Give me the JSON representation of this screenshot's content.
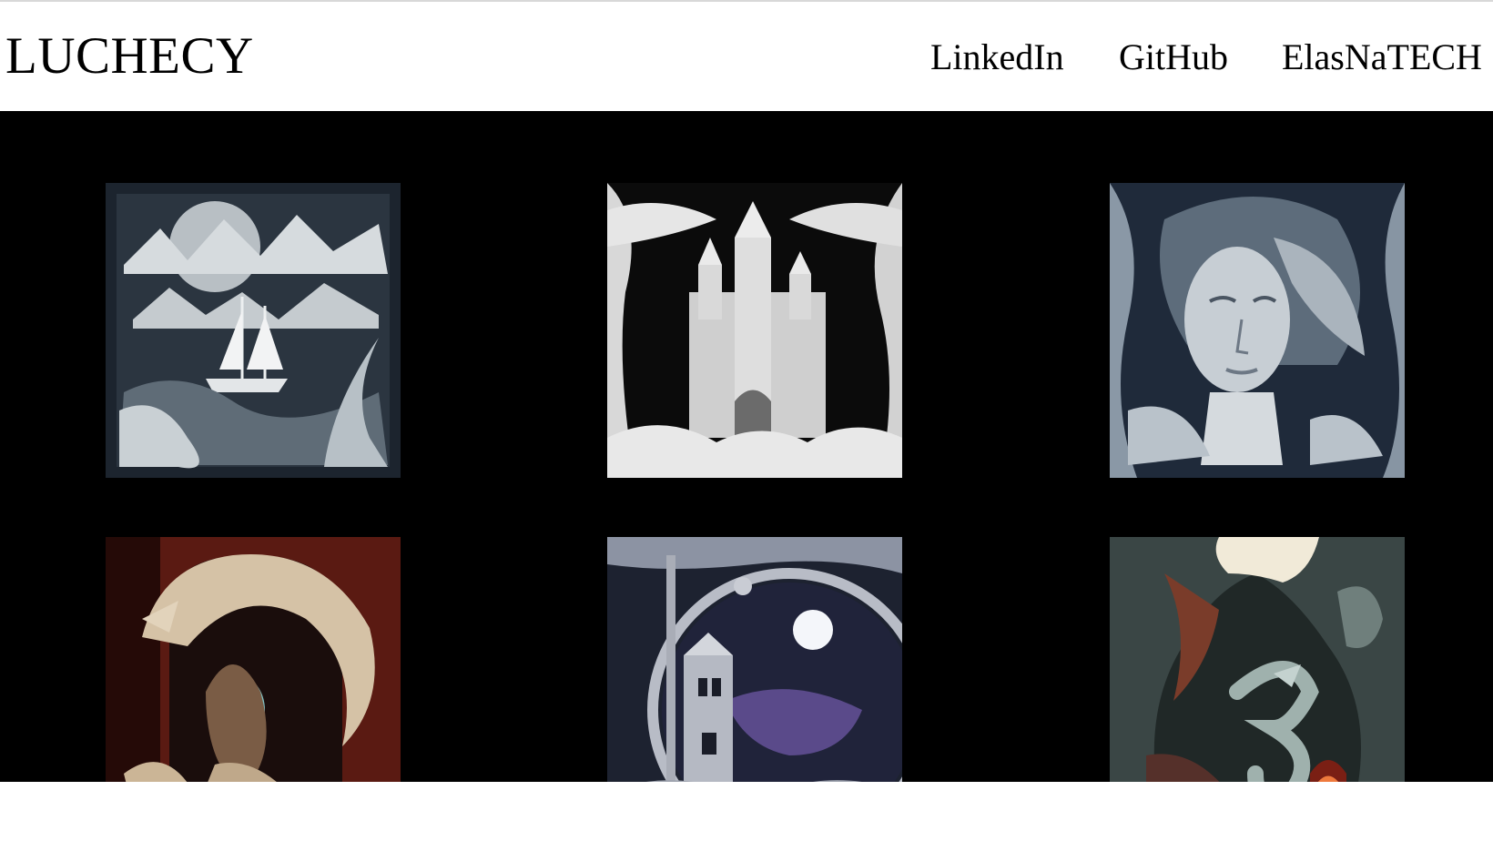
{
  "header": {
    "brand": "LUCHECY",
    "nav": [
      {
        "label": "LinkedIn"
      },
      {
        "label": "GitHub"
      },
      {
        "label": "ElasNaTECH"
      }
    ]
  },
  "gallery": {
    "background": "#000000",
    "items": [
      {
        "icon": "paper-art-ship-image"
      },
      {
        "icon": "paper-art-castle-image"
      },
      {
        "icon": "paper-art-woman-face-image"
      },
      {
        "icon": "paper-art-dragon-mermaid-image"
      },
      {
        "icon": "paper-art-lighthouse-moon-image"
      },
      {
        "icon": "paper-art-dragon-cave-image"
      }
    ]
  }
}
